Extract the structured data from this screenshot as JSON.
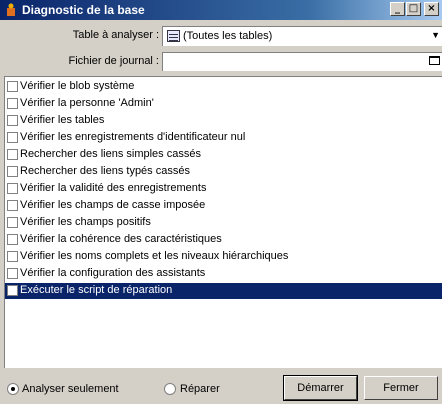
{
  "window": {
    "title": "Diagnostic de la base"
  },
  "title_buttons": {
    "minimize": "_",
    "maximize": "□",
    "close": "×"
  },
  "table_field": {
    "label": "Table à analyser :",
    "value": "(Toutes les tables)"
  },
  "journal_field": {
    "label": "Fichier de journal :",
    "value": ""
  },
  "checks": [
    {
      "label": "Vérifier le blob système",
      "checked": false,
      "selected": false
    },
    {
      "label": "Vérifier la personne 'Admin'",
      "checked": false,
      "selected": false
    },
    {
      "label": "Vérifier les tables",
      "checked": false,
      "selected": false
    },
    {
      "label": "Vérifier les enregistrements d'identificateur nul",
      "checked": false,
      "selected": false
    },
    {
      "label": "Rechercher des liens simples cassés",
      "checked": false,
      "selected": false
    },
    {
      "label": "Rechercher des liens typés cassés",
      "checked": false,
      "selected": false
    },
    {
      "label": "Vérifier la validité des enregistrements",
      "checked": false,
      "selected": false
    },
    {
      "label": "Vérifier les champs de casse imposée",
      "checked": false,
      "selected": false
    },
    {
      "label": "Vérifier les champs positifs",
      "checked": false,
      "selected": false
    },
    {
      "label": "Vérifier la cohérence des caractéristiques",
      "checked": false,
      "selected": false
    },
    {
      "label": "Vérifier les noms complets et les niveaux hiérarchiques",
      "checked": false,
      "selected": false
    },
    {
      "label": "Vérifier la configuration des assistants",
      "checked": false,
      "selected": false
    },
    {
      "label": "Exécuter le script de réparation",
      "checked": false,
      "selected": true
    }
  ],
  "mode": {
    "analyse_label": "Analyser seulement",
    "repair_label": "Réparer",
    "selected": "analyse"
  },
  "buttons": {
    "start": "Démarrer",
    "close": "Fermer"
  },
  "colors": {
    "title_bar": "#0a246a",
    "selection": "#0a246a",
    "face": "#d4d0c8"
  }
}
